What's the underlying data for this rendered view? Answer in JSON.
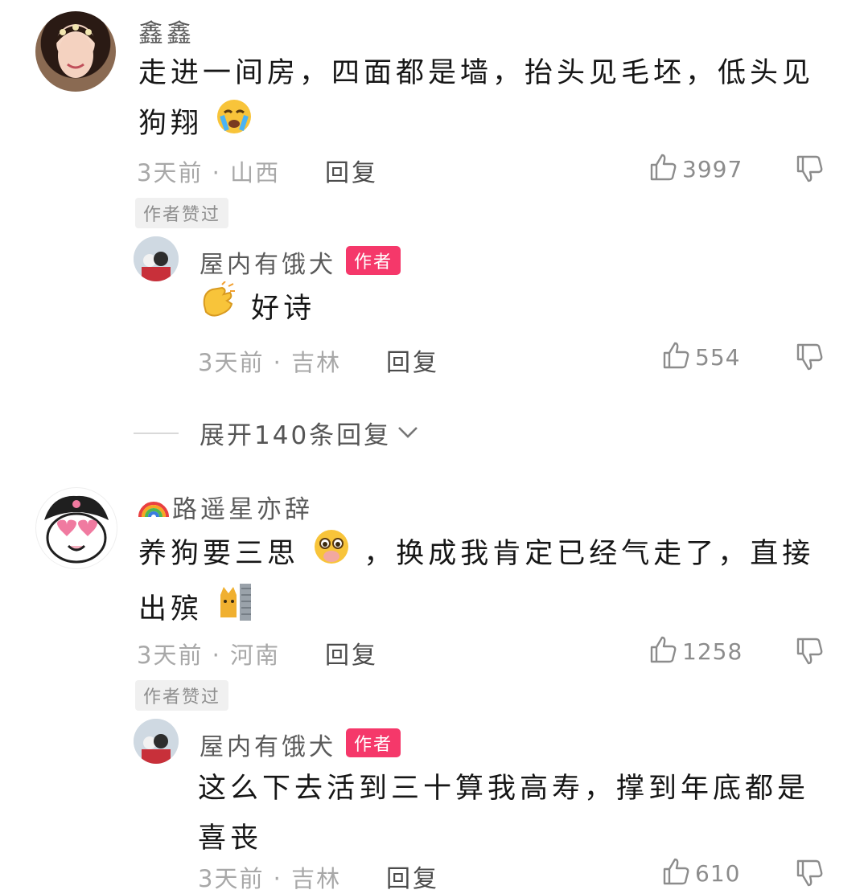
{
  "comments": [
    {
      "username": "鑫鑫",
      "text": "走进一间房，四面都是墙，抬头见毛坯，低头见狗翔",
      "text_line1": "走进一间房，四面都是墙，抬头见毛坯，低头见",
      "text_line2": "狗翔",
      "meta": "3天前 · 山西",
      "reply_label": "回复",
      "likes": "3997",
      "badge": "作者赞过",
      "emoji": "loudly-crying-face",
      "replies": [
        {
          "username": "屋内有饿犬",
          "tag": "作者",
          "text": "好诗",
          "emoji": "clapping-hands",
          "meta": "3天前 · 吉林",
          "reply_label": "回复",
          "likes": "554"
        }
      ],
      "expand_label": "展开140条回复"
    },
    {
      "username": "路遥星亦辞",
      "username_prefix_emoji": "rainbow",
      "text_line1": "养狗要三思",
      "text_line1b": "，换成我肯定已经气走了，直接",
      "text_line2": "出殡",
      "meta": "3天前 · 河南",
      "reply_label": "回复",
      "likes": "1258",
      "badge": "作者赞过",
      "replies": [
        {
          "username": "屋内有饿犬",
          "tag": "作者",
          "text_line1": "这么下去活到三十算我高寿，撑到年底都是",
          "text_line2": "喜丧",
          "meta": "3天前 · 吉林",
          "reply_label": "回复",
          "likes": "610"
        }
      ]
    }
  ],
  "colors": {
    "author_badge": "#f5386a",
    "liked_badge_bg": "#f0f0f0",
    "meta_text": "#a8a8a8"
  }
}
